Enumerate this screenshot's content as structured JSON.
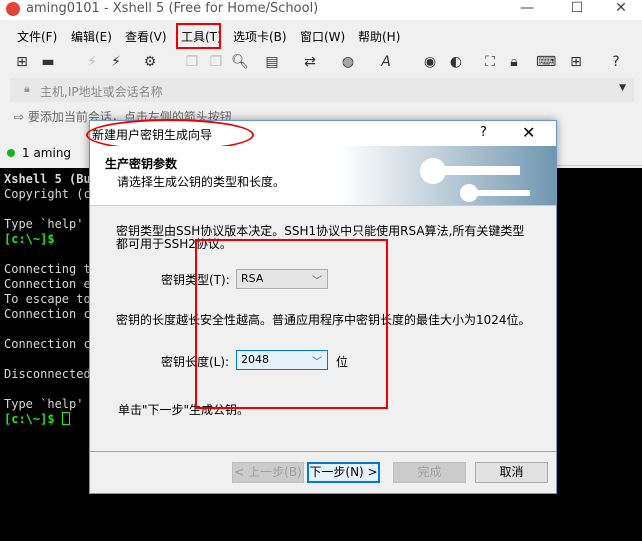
{
  "window": {
    "title": "aming0101 - Xshell 5 (Free for Home/School)",
    "minimize": "—",
    "maximize": "☐",
    "close": "✕"
  },
  "menu": [
    "文件(F)",
    "编辑(E)",
    "查看(V)",
    "工具(T)",
    "选项卡(B)",
    "窗口(W)",
    "帮助(H)"
  ],
  "toolbar_icons": [
    "new-session-icon",
    "open-folder-icon",
    "disconnect-icon",
    "connect-icon",
    "properties-icon",
    "copy-icon",
    "paste-icon",
    "find-icon",
    "print-icon",
    "transfer-icon",
    "globe-icon",
    "font-icon",
    "xshell-icon",
    "xftp-icon",
    "fullscreen-icon",
    "lock-icon",
    "keyboard-icon",
    "new-tab-icon",
    "help-icon"
  ],
  "address": {
    "placeholder": "主机,IP地址或会话名称"
  },
  "hint": "要添加当前会话，点击左侧的箭头按钮",
  "tab": {
    "label": "1 aming",
    "status_color": "#1db01d"
  },
  "terminal": {
    "lines": [
      "Xshell 5 (Bui",
      "Copyright (c",
      "",
      "Type `help' t",
      "[c:\\~]$",
      "",
      "Connecting to",
      "Connection es",
      "To escape to",
      "Connection cl",
      "",
      "Connection cl",
      "",
      "Disconnected",
      "",
      "Type `help' t",
      "[c:\\~]$ "
    ]
  },
  "dialog": {
    "title": "新建用户密钥生成向导",
    "help": "?",
    "close": "✕",
    "heading": "生产密钥参数",
    "subheading": "请选择生成公钥的类型和长度。",
    "type_desc": "密钥类型由SSH协议版本决定。SSH1协议中只能使用RSA算法,所有关键类型都可用于SSH2协议。",
    "type_label": "密钥类型(T):",
    "type_value": "RSA",
    "len_desc": "密钥的长度越长安全性越高。普通应用程序中密钥长度的最佳大小为1024位。",
    "len_label": "密钥长度(L):",
    "len_value": "2048",
    "len_unit": "位",
    "instruction": "单击\"下一步\"生成公钥。",
    "buttons": {
      "back": "< 上一步(B)",
      "next": "下一步(N) >",
      "finish": "完成",
      "cancel": "取消"
    }
  },
  "annotation_color": "#e00000"
}
